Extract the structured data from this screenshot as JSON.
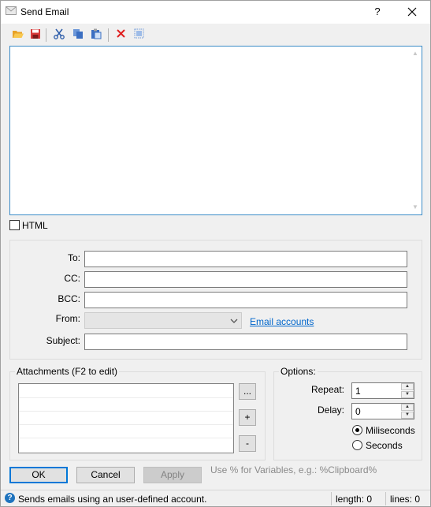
{
  "window": {
    "title": "Send Email",
    "help_label": "?",
    "close_icon": "close-icon"
  },
  "toolbar": {
    "icons": [
      "open-folder-icon",
      "save-icon",
      "cut-icon",
      "copy-icon",
      "paste-icon",
      "delete-icon",
      "select-all-icon"
    ]
  },
  "body": {
    "text": "",
    "html_label": "HTML",
    "html_checked": false
  },
  "fields": {
    "to_label": "To:",
    "cc_label": "CC:",
    "bcc_label": "BCC:",
    "from_label": "From:",
    "subject_label": "Subject:",
    "to_value": "",
    "cc_value": "",
    "bcc_value": "",
    "from_value": "",
    "subject_value": "",
    "email_accounts_link": "Email accounts"
  },
  "attachments": {
    "title": "Attachments (F2 to edit)",
    "items": [],
    "browse_label": "...",
    "add_label": "+",
    "remove_label": "-"
  },
  "options": {
    "title": "Options:",
    "repeat_label": "Repeat:",
    "repeat_value": "1",
    "delay_label": "Delay:",
    "delay_value": "0",
    "unit_options": [
      "Miliseconds",
      "Seconds"
    ],
    "unit_selected": "Miliseconds"
  },
  "buttons": {
    "ok": "OK",
    "cancel": "Cancel",
    "apply": "Apply"
  },
  "hint": "Use % for Variables, e.g.: %Clipboard%",
  "status": {
    "text": "Sends emails using an user-defined account.",
    "length": "length: 0",
    "lines": "lines: 0"
  },
  "colors": {
    "accent": "#0078d7",
    "link": "#0066cc",
    "info_icon": "#1e73be"
  }
}
